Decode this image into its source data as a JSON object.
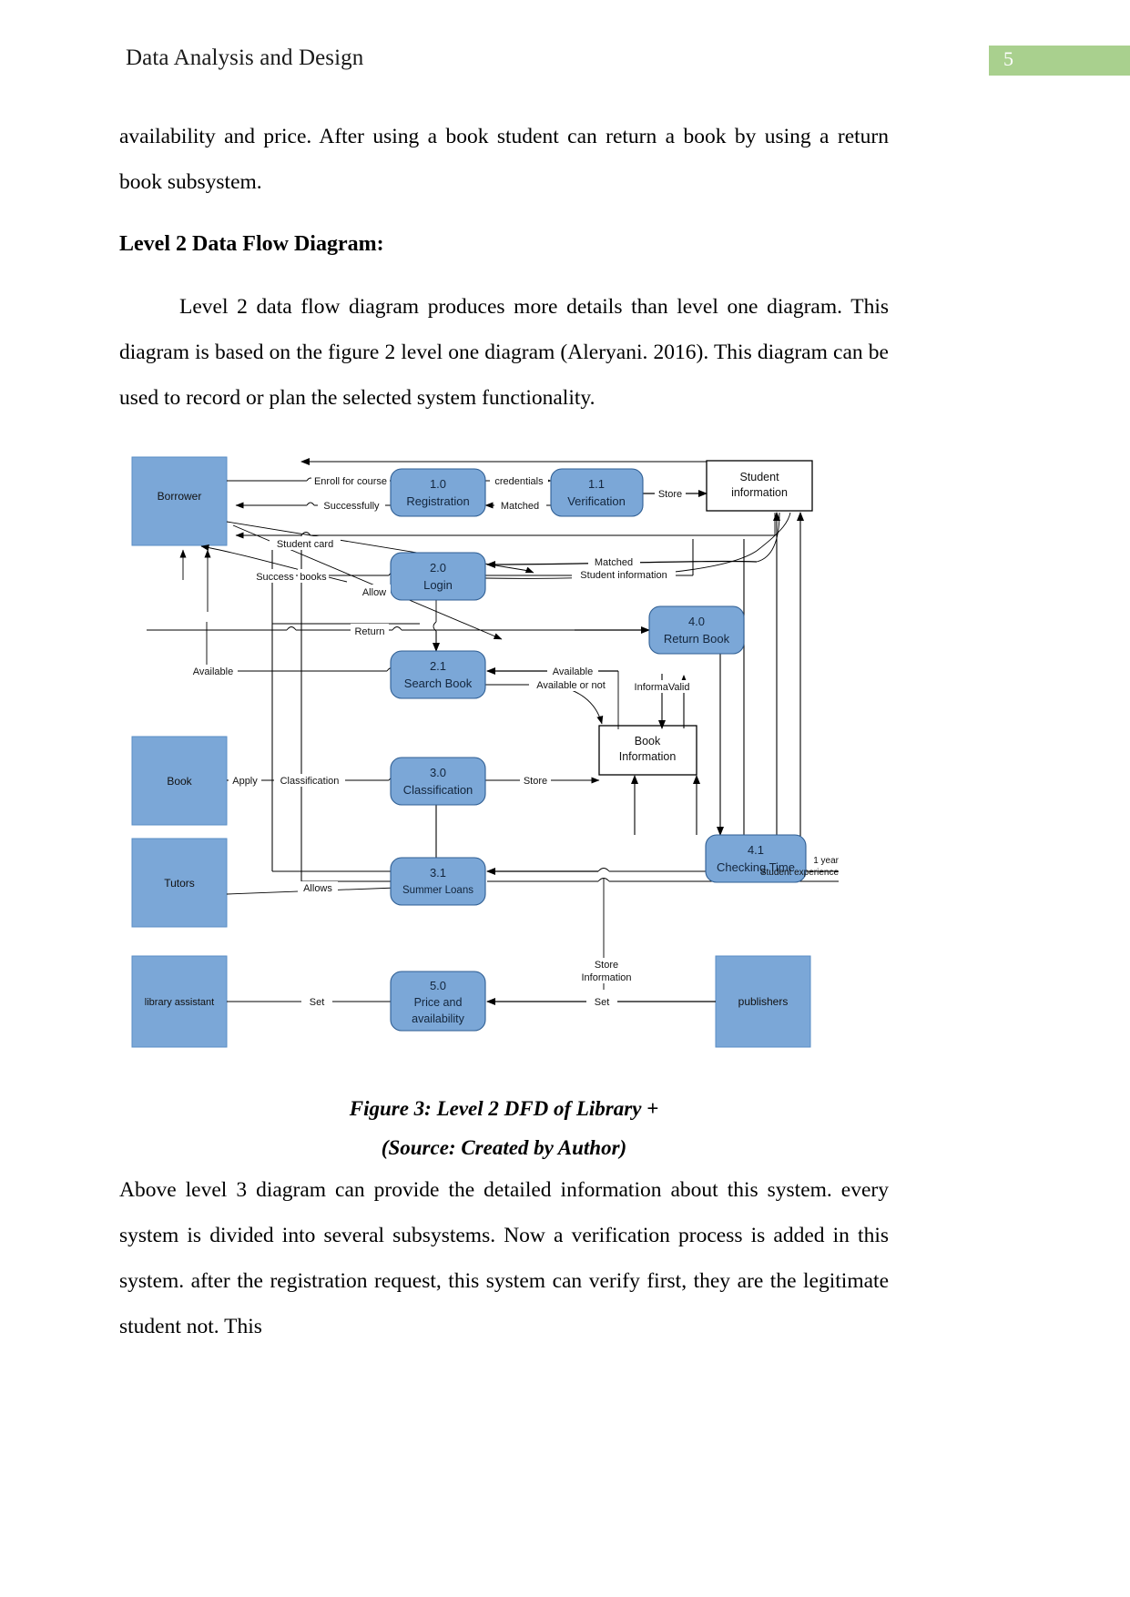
{
  "header": {
    "title": "Data Analysis and Design",
    "page_number": "5",
    "page_number_bg": "#a9d08e"
  },
  "body": {
    "para1": "availability and price. After using a book student can return a book by using a return book subsystem.",
    "heading1": "Level 2 Data Flow Diagram:",
    "para2": "Level 2 data flow diagram produces more details than level one diagram. This diagram is based on the figure 2 level one diagram (Aleryani. 2016). This diagram can be used to record or plan the selected system functionality.",
    "caption_line1": "Figure 3: Level 2 DFD of Library +",
    "caption_line2": "(Source: Created by Author)",
    "para3": "Above level 3 diagram can provide the detailed information about this system. every system is divided into several subsystems. Now a verification process is added in this system. after the registration request, this system can verify first, they are the legitimate student not. This"
  },
  "diagram": {
    "colors": {
      "entity_fill": "#7BA7D7",
      "process_fill": "#7BA7D7",
      "stroke": "#2F4F6F",
      "line": "#000000",
      "datastore_fill": "#ffffff"
    },
    "entities": [
      {
        "id": "borrower",
        "label": "Borrower"
      },
      {
        "id": "book",
        "label": "Book"
      },
      {
        "id": "tutors",
        "label": "Tutors"
      },
      {
        "id": "library-assistant",
        "label": "library assistant"
      },
      {
        "id": "publishers",
        "label": "publishers"
      }
    ],
    "processes": [
      {
        "id": "p10",
        "number": "1.0",
        "name": "Registration"
      },
      {
        "id": "p11",
        "number": "1.1",
        "name": "Verification"
      },
      {
        "id": "p20",
        "number": "2.0",
        "name": "Login"
      },
      {
        "id": "p21",
        "number": "2.1",
        "name": "Search Book"
      },
      {
        "id": "p30",
        "number": "3.0",
        "name": "Classification"
      },
      {
        "id": "p31",
        "number": "3.1",
        "name": "Summer Loans"
      },
      {
        "id": "p40",
        "number": "4.0",
        "name": "Return Book"
      },
      {
        "id": "p41",
        "number": "4.1",
        "name": "Checking Time"
      },
      {
        "id": "p50",
        "number": "5.0",
        "name": "Price and availability",
        "name_line1": "Price and",
        "name_line2": "availability"
      }
    ],
    "datastores": [
      {
        "id": "student-information",
        "line1": "Student",
        "line2": "information"
      },
      {
        "id": "book-information",
        "line1": "Book",
        "line2": "Information"
      }
    ],
    "flow_labels": [
      {
        "id": "enroll-for-course",
        "text": "Enroll for course"
      },
      {
        "id": "successfully",
        "text": "Successfully"
      },
      {
        "id": "credentials",
        "text": "credentials"
      },
      {
        "id": "matched-1",
        "text": "Matched"
      },
      {
        "id": "store-1",
        "text": "Store"
      },
      {
        "id": "student-card",
        "text": "Student card"
      },
      {
        "id": "success",
        "text": "Success"
      },
      {
        "id": "books",
        "text": "books"
      },
      {
        "id": "allow",
        "text": "Allow"
      },
      {
        "id": "return",
        "text": "Return"
      },
      {
        "id": "matched-2",
        "text": "Matched"
      },
      {
        "id": "student-information-flow",
        "text": "Student information"
      },
      {
        "id": "available-1",
        "text": "Available"
      },
      {
        "id": "available-2",
        "text": "Available"
      },
      {
        "id": "available-or-not",
        "text": "Available or not"
      },
      {
        "id": "informavalid",
        "text": "InformaValid"
      },
      {
        "id": "apply",
        "text": "Apply"
      },
      {
        "id": "classification",
        "text": "Classification"
      },
      {
        "id": "store-2",
        "text": "Store"
      },
      {
        "id": "allows",
        "text": "Allows"
      },
      {
        "id": "one-year",
        "text": "1 year"
      },
      {
        "id": "student-experience",
        "text": "Student experience"
      },
      {
        "id": "store-information-1",
        "text": "Store"
      },
      {
        "id": "store-information-2",
        "text": "Information"
      },
      {
        "id": "set-1",
        "text": "Set"
      },
      {
        "id": "set-2",
        "text": "Set"
      }
    ]
  }
}
